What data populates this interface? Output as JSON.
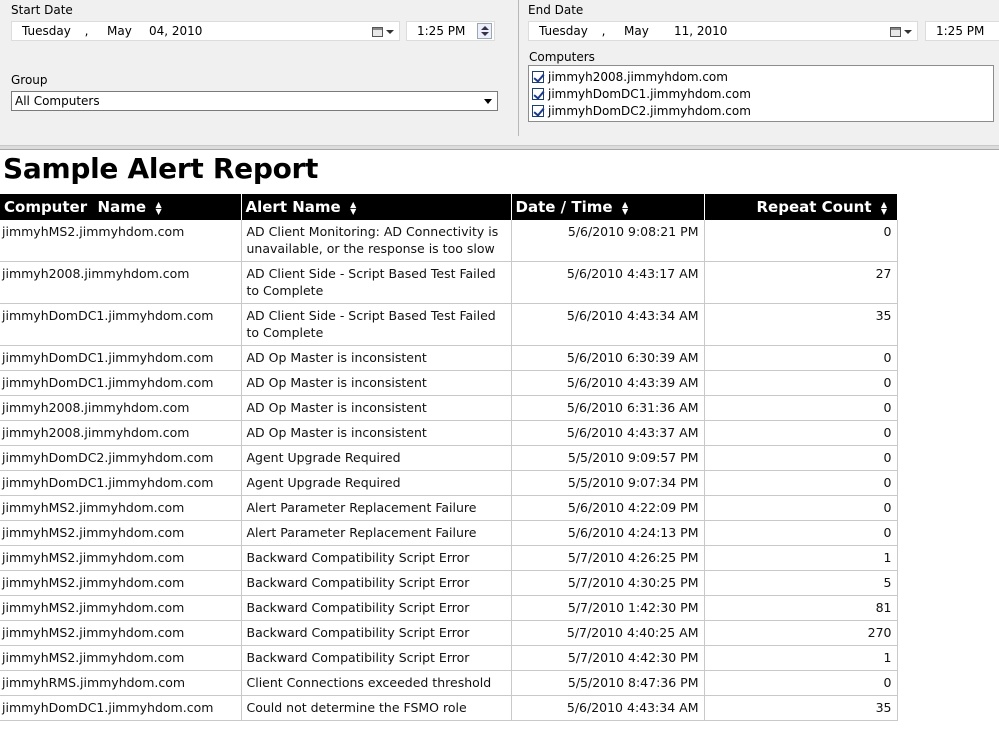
{
  "params": {
    "start_label": "Start Date",
    "start_weekday": "Tuesday",
    "start_sep": ",",
    "start_month": "May",
    "start_day_year": "04, 2010",
    "start_time": "1:25 PM",
    "end_label": "End Date",
    "end_weekday": "Tuesday",
    "end_sep": ",",
    "end_month": "May",
    "end_day_year": "11, 2010",
    "end_time": "1:25 PM",
    "group_label": "Group",
    "group_value": "All Computers",
    "computers_label": "Computers",
    "computers": [
      "jimmyh2008.jimmyhdom.com",
      "jimmyhDomDC1.jimmyhdom.com",
      "jimmyhDomDC2.jimmyhdom.com"
    ]
  },
  "report": {
    "title": "Sample Alert Report",
    "columns": [
      "Computer  Name",
      "Alert Name",
      "Date / Time",
      "Repeat Count"
    ],
    "sort_icon": "sort-arrows-icon",
    "rows": [
      {
        "computer": "jimmyhMS2.jimmyhdom.com",
        "alert": "AD Client Monitoring: AD Connectivity is unavailable, or the response is too slow",
        "datetime": "5/6/2010 9:08:21 PM",
        "count": "0"
      },
      {
        "computer": "jimmyh2008.jimmyhdom.com",
        "alert": "AD Client Side - Script Based Test Failed to Complete",
        "datetime": "5/6/2010 4:43:17 AM",
        "count": "27"
      },
      {
        "computer": "jimmyhDomDC1.jimmyhdom.com",
        "alert": "AD Client Side - Script Based Test Failed to Complete",
        "datetime": "5/6/2010 4:43:34 AM",
        "count": "35"
      },
      {
        "computer": "jimmyhDomDC1.jimmyhdom.com",
        "alert": "AD Op Master is inconsistent",
        "datetime": "5/6/2010 6:30:39 AM",
        "count": "0"
      },
      {
        "computer": "jimmyhDomDC1.jimmyhdom.com",
        "alert": "AD Op Master is inconsistent",
        "datetime": "5/6/2010 4:43:39 AM",
        "count": "0"
      },
      {
        "computer": "jimmyh2008.jimmyhdom.com",
        "alert": "AD Op Master is inconsistent",
        "datetime": "5/6/2010 6:31:36 AM",
        "count": "0"
      },
      {
        "computer": "jimmyh2008.jimmyhdom.com",
        "alert": "AD Op Master is inconsistent",
        "datetime": "5/6/2010 4:43:37 AM",
        "count": "0"
      },
      {
        "computer": "jimmyhDomDC2.jimmyhdom.com",
        "alert": "Agent Upgrade Required",
        "datetime": "5/5/2010 9:09:57 PM",
        "count": "0"
      },
      {
        "computer": "jimmyhDomDC1.jimmyhdom.com",
        "alert": "Agent Upgrade Required",
        "datetime": "5/5/2010 9:07:34 PM",
        "count": "0"
      },
      {
        "computer": "jimmyhMS2.jimmyhdom.com",
        "alert": "Alert Parameter Replacement Failure",
        "datetime": "5/6/2010 4:22:09 PM",
        "count": "0"
      },
      {
        "computer": "jimmyhMS2.jimmyhdom.com",
        "alert": "Alert Parameter Replacement Failure",
        "datetime": "5/6/2010 4:24:13 PM",
        "count": "0"
      },
      {
        "computer": "jimmyhMS2.jimmyhdom.com",
        "alert": "Backward Compatibility Script Error",
        "datetime": "5/7/2010 4:26:25 PM",
        "count": "1"
      },
      {
        "computer": "jimmyhMS2.jimmyhdom.com",
        "alert": "Backward Compatibility Script Error",
        "datetime": "5/7/2010 4:30:25 PM",
        "count": "5"
      },
      {
        "computer": "jimmyhMS2.jimmyhdom.com",
        "alert": "Backward Compatibility Script Error",
        "datetime": "5/7/2010 1:42:30 PM",
        "count": "81"
      },
      {
        "computer": "jimmyhMS2.jimmyhdom.com",
        "alert": "Backward Compatibility Script Error",
        "datetime": "5/7/2010 4:40:25 AM",
        "count": "270"
      },
      {
        "computer": "jimmyhMS2.jimmyhdom.com",
        "alert": "Backward Compatibility Script Error",
        "datetime": "5/7/2010 4:42:30 PM",
        "count": "1"
      },
      {
        "computer": "jimmyhRMS.jimmyhdom.com",
        "alert": "Client Connections  exceeded threshold",
        "datetime": "5/5/2010 8:47:36 PM",
        "count": "0"
      },
      {
        "computer": "jimmyhDomDC1.jimmyhdom.com",
        "alert": "Could not determine the FSMO role",
        "datetime": "5/6/2010 4:43:34 AM",
        "count": "35"
      }
    ]
  }
}
